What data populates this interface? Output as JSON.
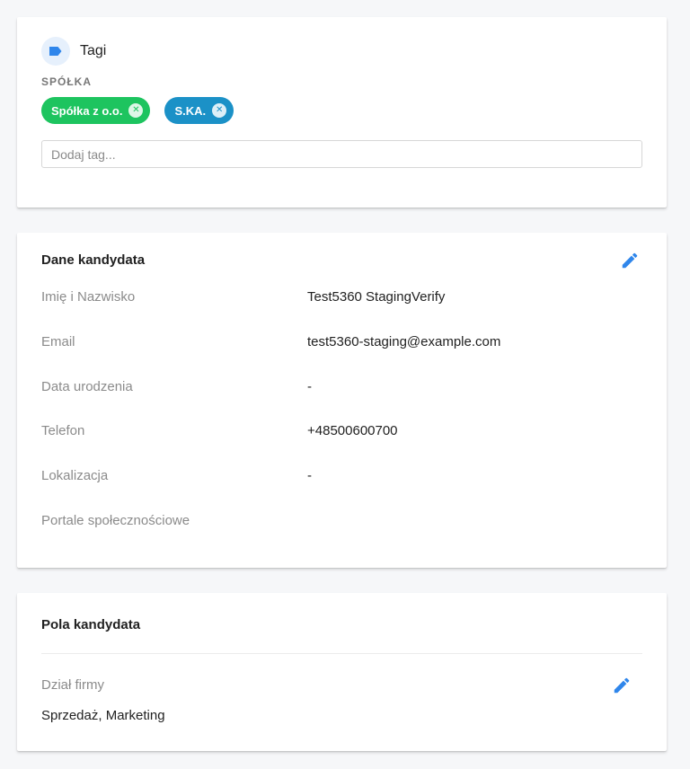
{
  "tags_card": {
    "title": "Tagi",
    "icon": "label-icon",
    "group_label": "SPÓŁKA",
    "chips": [
      {
        "label": "Spółka z o.o.",
        "color": "#1dc45f"
      },
      {
        "label": "S.KA.",
        "color": "#1b91c7"
      }
    ],
    "input_placeholder": "Dodaj tag..."
  },
  "candidate_data": {
    "title": "Dane kandydata",
    "rows": [
      {
        "label": "Imię i Nazwisko",
        "value": "Test5360 StagingVerify"
      },
      {
        "label": "Email",
        "value": "test5360-staging@example.com"
      },
      {
        "label": "Data urodzenia",
        "value": "-"
      },
      {
        "label": "Telefon",
        "value": "+48500600700"
      },
      {
        "label": "Lokalizacja",
        "value": "-"
      },
      {
        "label": "Portale społecznościowe",
        "value": ""
      }
    ]
  },
  "candidate_fields": {
    "title": "Pola kandydata",
    "field_label": "Dział firmy",
    "field_value": "Sprzedaż, Marketing"
  },
  "colors": {
    "accent": "#2f86eb",
    "chip_green": "#1dc45f",
    "chip_blue": "#1b91c7"
  }
}
